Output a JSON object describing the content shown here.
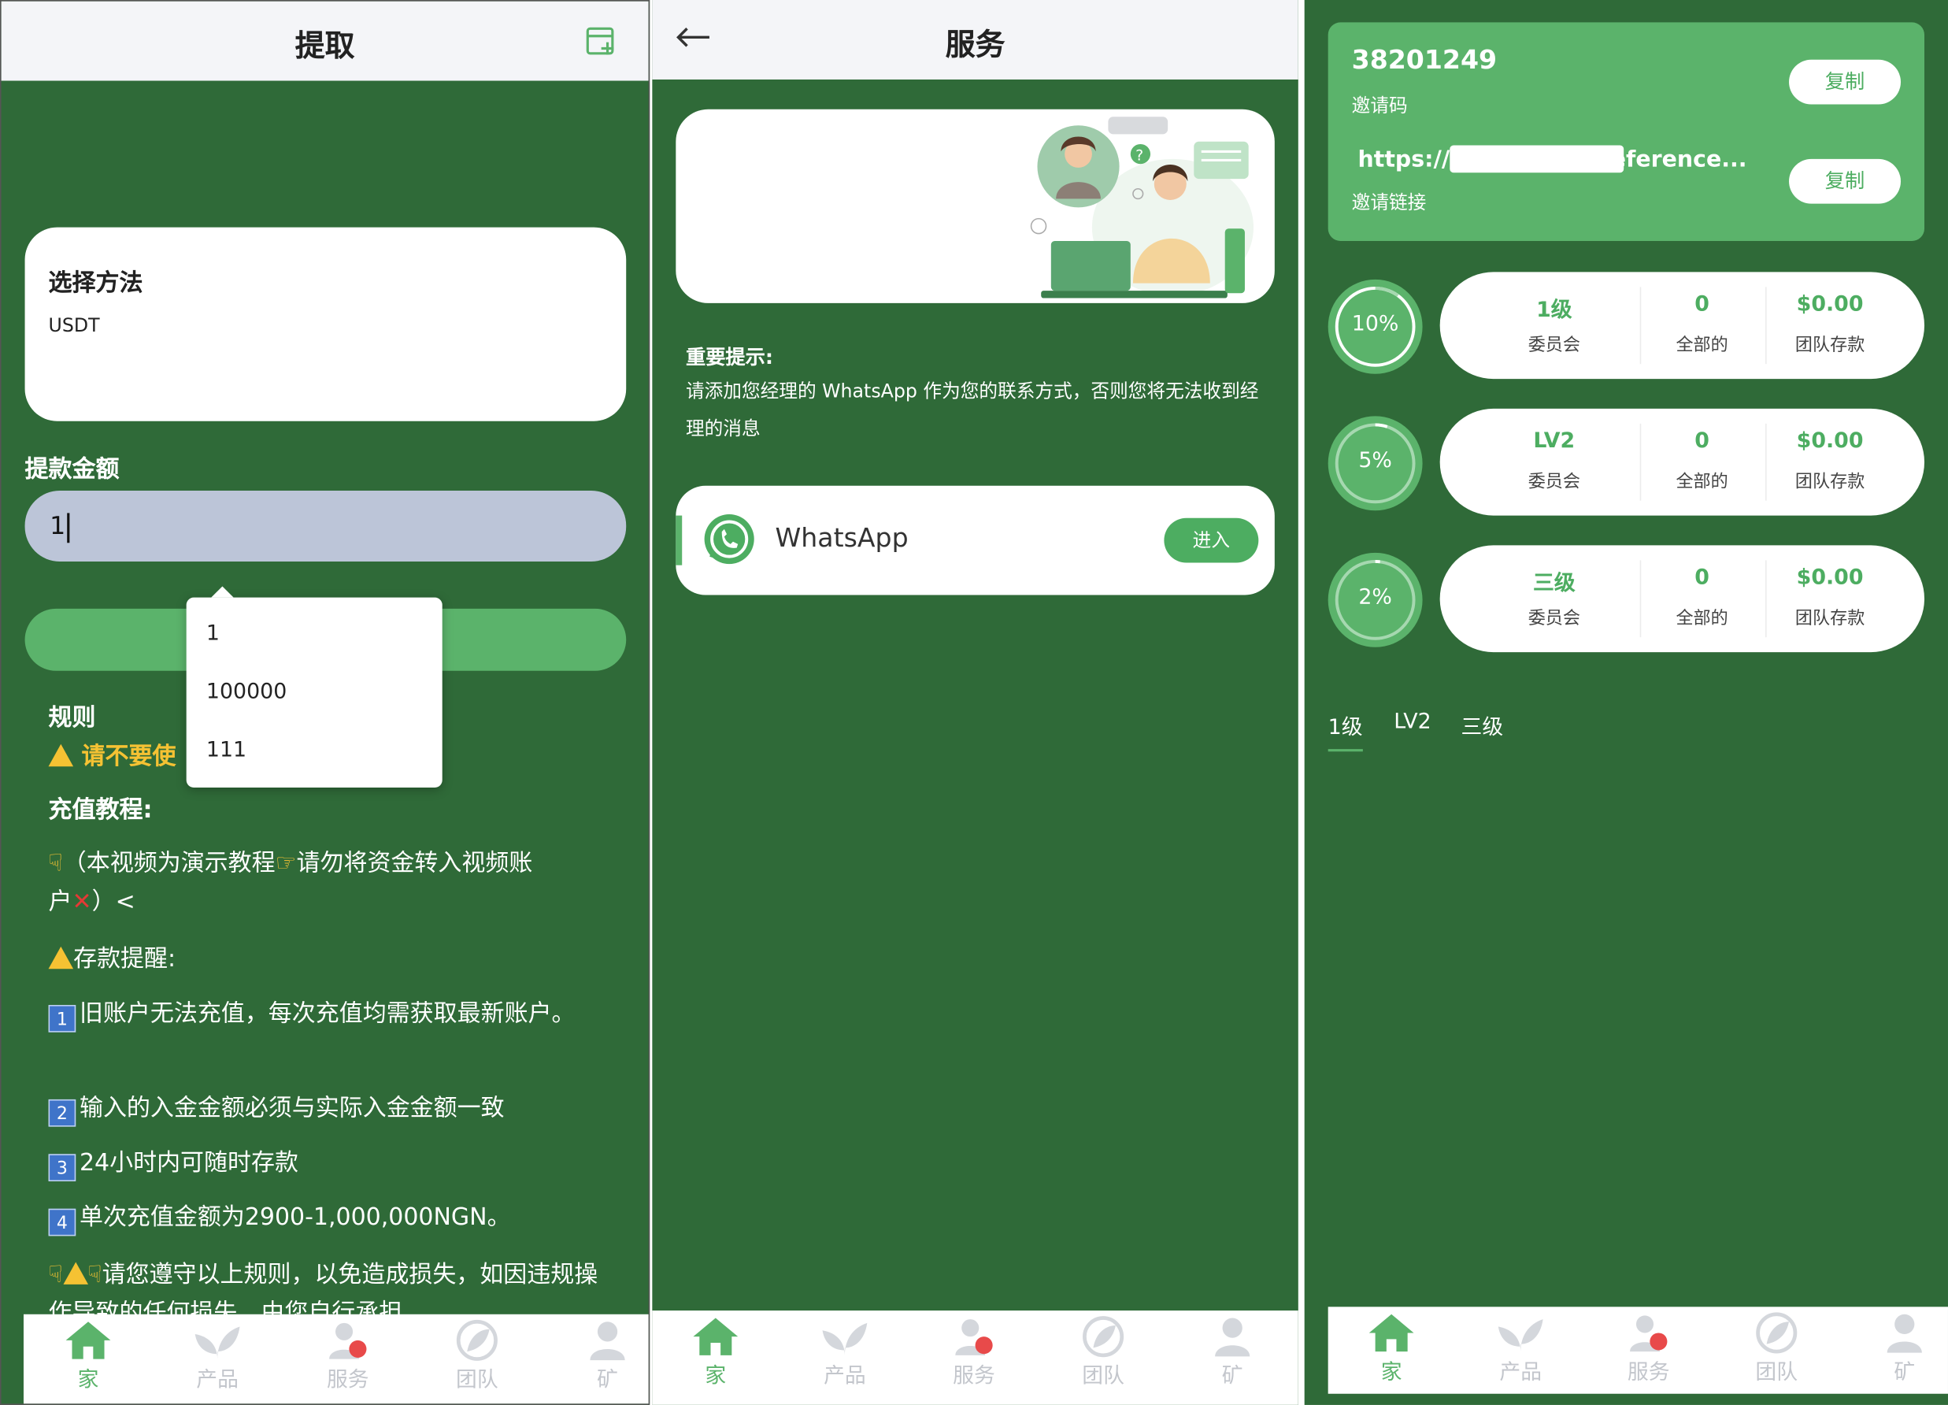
{
  "colors": {
    "brand_green": "#5bb36b",
    "background_green": "#2f6a38",
    "input_fill": "#bcc5d8",
    "warning": "#f5c233"
  },
  "withdraw": {
    "title": "提取",
    "method_title": "选择方法",
    "method_value": "USDT",
    "amount_label": "提款金额",
    "amount_value": "1",
    "autocomplete_options": [
      "1",
      "100000",
      "111"
    ],
    "rules_title": "规则",
    "rules_warning": "请不要使",
    "tutorial_title": "充值教程:",
    "tutorial_line": "（本视频为演示教程",
    "tutorial_line_b": "请勿将资金转入视频账",
    "tutorial_line_c": "户",
    "tutorial_line_d": "）<",
    "deposit_tip_title": "存款提醒:",
    "rule_1": "旧账户无法充值，每次充值均需获取最新账户。",
    "rule_2": "输入的入金金额必须与实际入金金额一致",
    "rule_3": "24小时内可随时存款",
    "rule_4": "单次充值金额为2900-1,000,000NGN。",
    "rule_5": "请您遵守以上规则，以免造成损失，如因违规操作导致的任何损失，由您自行承担。",
    "rule_numbers": [
      "1",
      "2",
      "3",
      "4"
    ],
    "icons": {
      "header_action": "add-calendar-icon"
    }
  },
  "service": {
    "title": "服务",
    "notice_title": "重要提示:",
    "notice_text": "请添加您经理的 WhatsApp 作为您的联系方式，否则您将无法收到经理的消息",
    "channel_name": "WhatsApp",
    "enter_label": "进入",
    "icons": {
      "back": "back-arrow-icon",
      "channel": "whatsapp-icon"
    }
  },
  "team": {
    "invite_code": "38201249",
    "invite_code_label": "邀请码",
    "invite_link_start": "https://x",
    "invite_link_end": "eference...",
    "invite_link_label": "邀请链接",
    "copy_label": "复制",
    "levels": [
      {
        "percent": "10%",
        "ratio": 0.1,
        "name": "1级",
        "name_label": "委员会",
        "count": "0",
        "count_label": "全部的",
        "amount": "$0.00",
        "amount_label": "团队存款"
      },
      {
        "percent": "5%",
        "ratio": 0.05,
        "name": "LV2",
        "name_label": "委员会",
        "count": "0",
        "count_label": "全部的",
        "amount": "$0.00",
        "amount_label": "团队存款"
      },
      {
        "percent": "2%",
        "ratio": 0.02,
        "name": "三级",
        "name_label": "委员会",
        "count": "0",
        "count_label": "全部的",
        "amount": "$0.00",
        "amount_label": "团队存款"
      }
    ],
    "tabs": [
      "1级",
      "LV2",
      "三级"
    ],
    "active_tab": "1级"
  },
  "nav": {
    "items": [
      {
        "label": "家",
        "icon": "home-icon"
      },
      {
        "label": "产品",
        "icon": "leaf-icon"
      },
      {
        "label": "服务",
        "icon": "service-agent-icon"
      },
      {
        "label": "团队",
        "icon": "team-icon"
      },
      {
        "label": "矿",
        "icon": "miner-icon"
      }
    ]
  }
}
